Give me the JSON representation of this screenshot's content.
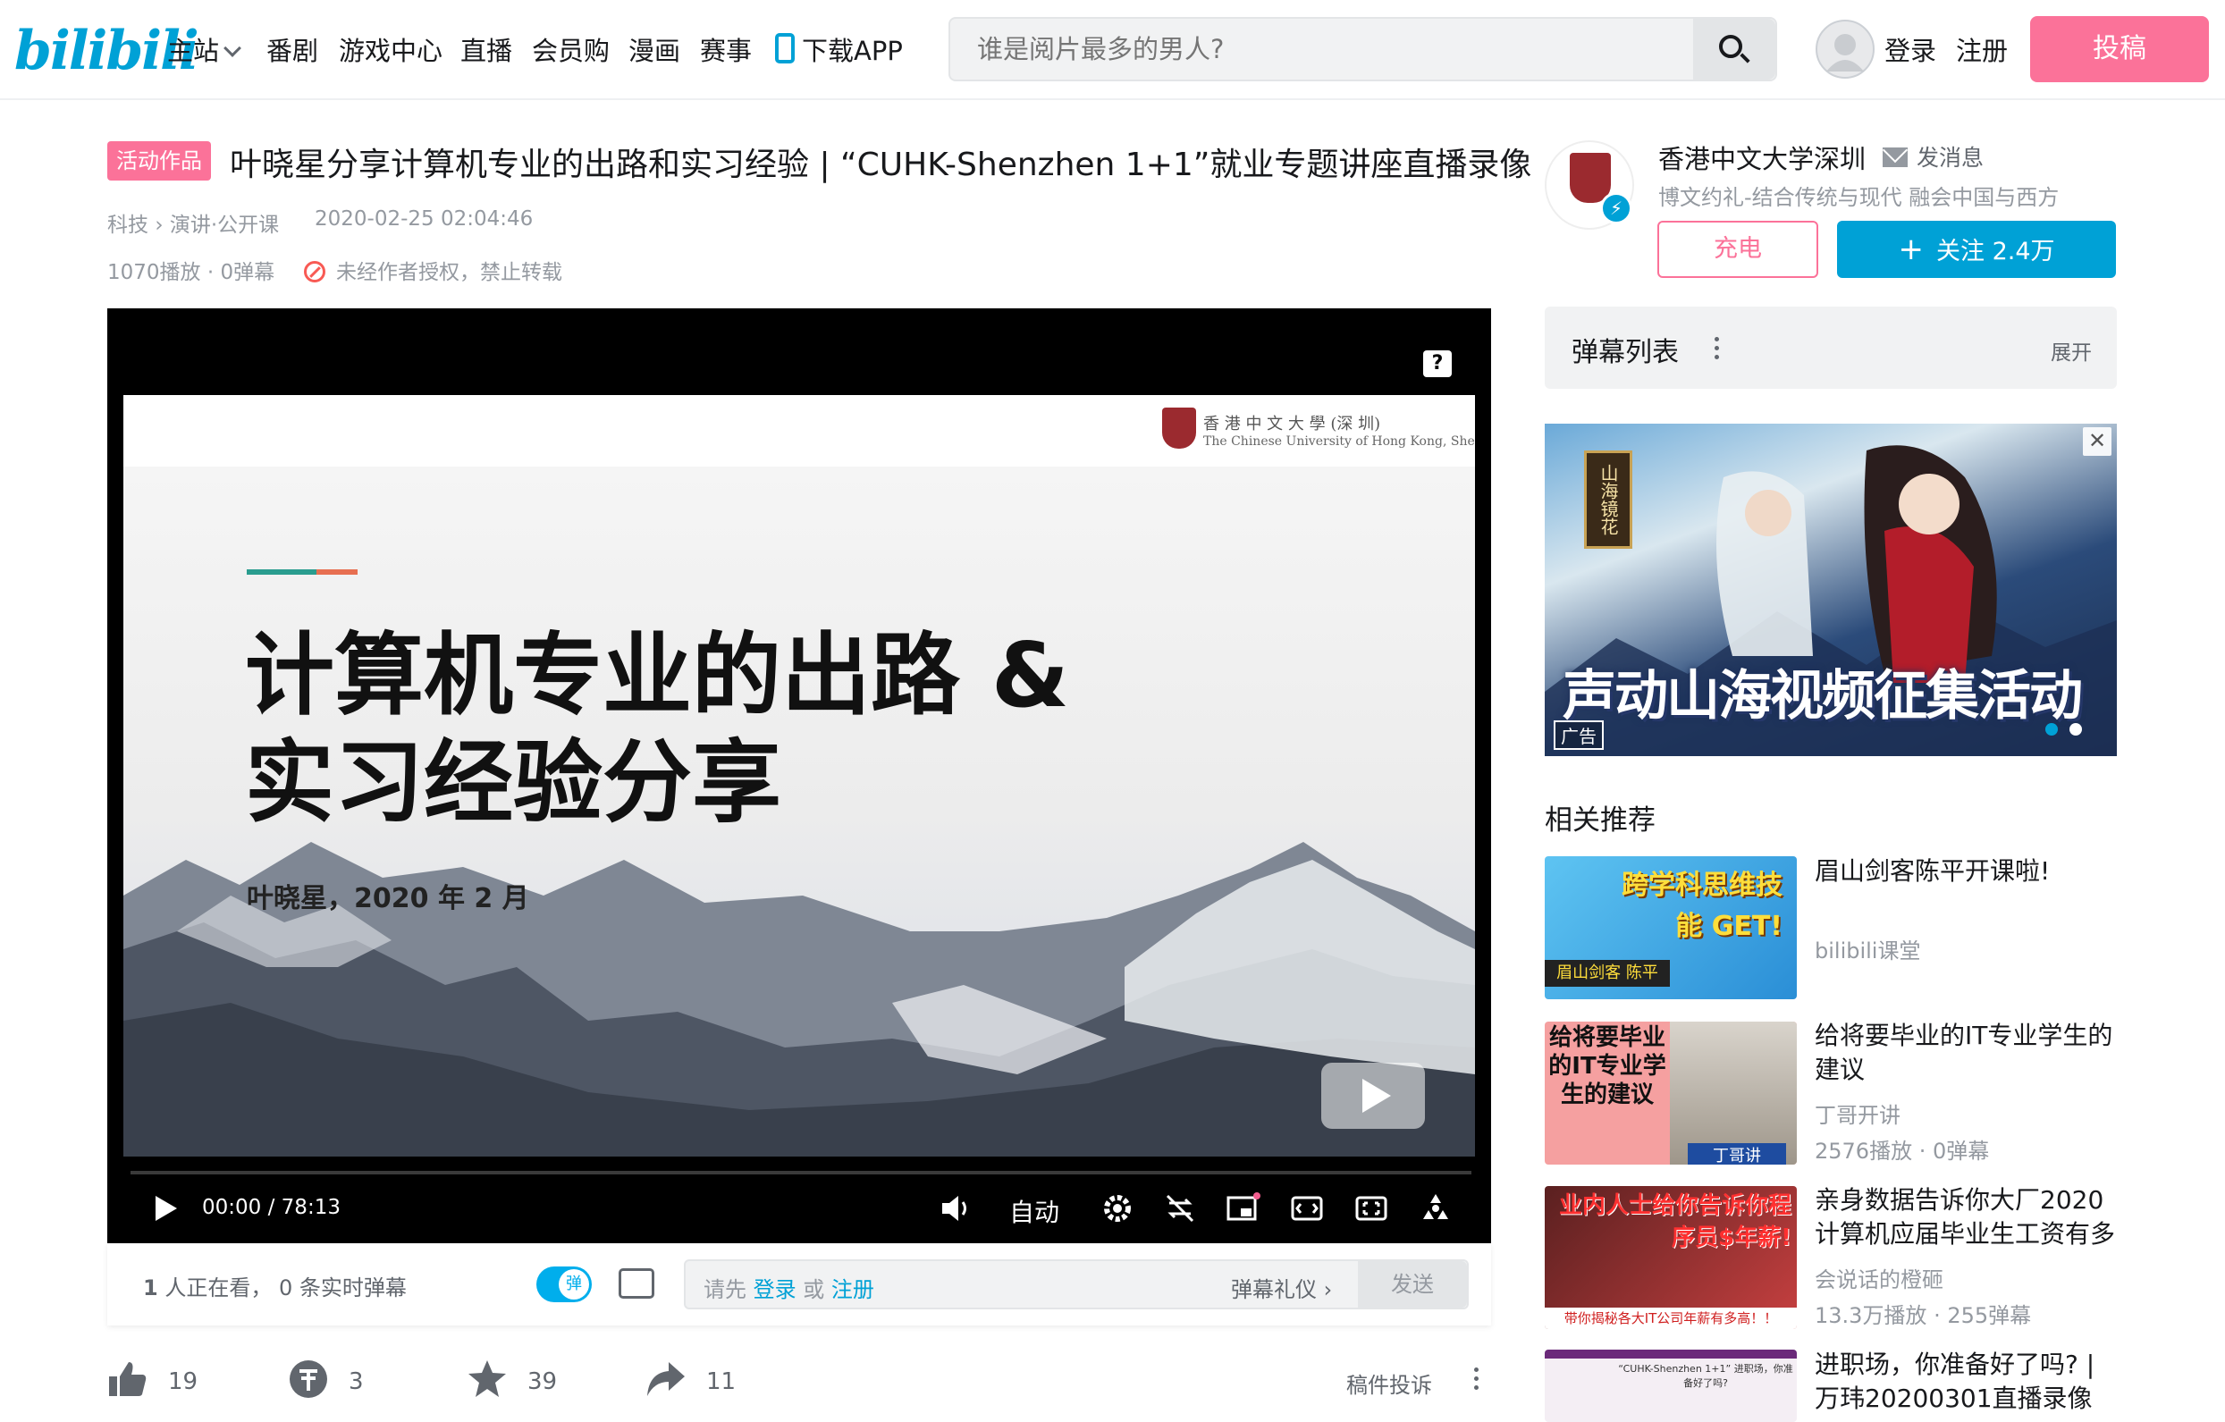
{
  "header": {
    "logo": "bilibili",
    "nav": [
      "主站",
      "番剧",
      "游戏中心",
      "直播",
      "会员购",
      "漫画",
      "赛事",
      "下载APP"
    ],
    "search_placeholder": "谁是阅片最多的男人?",
    "login": "登录",
    "register": "注册",
    "upload": "投稿"
  },
  "video": {
    "tag": "活动作品",
    "title": "叶晓星分享计算机专业的出路和实习经验 | “CUHK-Shenzhen 1+1”就业专题讲座直播录像",
    "category": "科技",
    "subcategory": "演讲·公开课",
    "date": "2020-02-25 02:04:46",
    "stats": "1070播放 · 0弹幕",
    "copyright": "未经作者授权，禁止转载"
  },
  "player": {
    "slide": {
      "heading_line1": "计算机专业的出路 &",
      "heading_line2": "实习经验分享",
      "subtitle": "叶晓星，2020 年 2 月",
      "uni_cn": "香 港 中 文 大 學 (深 圳)",
      "uni_en": "The Chinese University of Hong Kong, Shenzhen"
    },
    "time_current": "00:00",
    "time_sep": "/",
    "time_total": "78:13",
    "quality": "自动",
    "help": "?"
  },
  "danmaku_bar": {
    "watching_count": "1",
    "watching_text": "人正在看，",
    "realtime_count": "0",
    "realtime_text": "条实时弹幕",
    "toggle_label": "弹",
    "input_prefix": "请先",
    "input_login": "登录",
    "input_or": "或",
    "input_register": "注册",
    "etiquette": "弹幕礼仪",
    "send": "发送"
  },
  "toolbar": {
    "like": "19",
    "coin": "3",
    "favorite": "39",
    "share": "11",
    "report": "稿件投诉"
  },
  "uploader": {
    "name": "香港中文大学深圳",
    "message": "发消息",
    "description": "博文约礼-结合传统与现代 融会中国与西方",
    "charge": "充电",
    "follow": "关注 2.4万"
  },
  "danmaku_list": {
    "title": "弹幕列表",
    "expand": "展开"
  },
  "ad": {
    "side_text": "山海镜花",
    "title": "声动山海视频征集活动",
    "badge": "广告"
  },
  "recommendations": {
    "title": "相关推荐",
    "items": [
      {
        "title": "眉山剑客陈平开课啦!",
        "author": "bilibili课堂",
        "stats": "",
        "thumb_text": "跨学科思维技能 GET!",
        "thumb_sub": "眉山剑客 陈平"
      },
      {
        "title": "给将要毕业的IT专业学生的建议",
        "author": "丁哥开讲",
        "stats": "2576播放 · 0弹幕",
        "thumb_text": "给将要毕业的IT专业学生的建议",
        "thumb_sub": "丁哥讲"
      },
      {
        "title": "亲身数据告诉你大厂2020计算机应届毕业生工资有多",
        "author": "会说话的橙砸",
        "stats": "13.3万播放 · 255弹幕",
        "thumb_text": "业内人士给你告诉你程序员$年薪!",
        "thumb_sub": "带你揭秘各大IT公司年薪有多高！！"
      },
      {
        "title": "进职场，你准备好了吗? | 万玮20200301直播录像",
        "author": "",
        "stats": "",
        "thumb_text": "“CUHK-Shenzhen 1+1” 进职场，你准备好了吗?",
        "thumb_sub": ""
      }
    ]
  },
  "colors": {
    "brand_blue": "#00a1d6",
    "brand_pink": "#fb7299",
    "text_gray": "#9499a0"
  }
}
